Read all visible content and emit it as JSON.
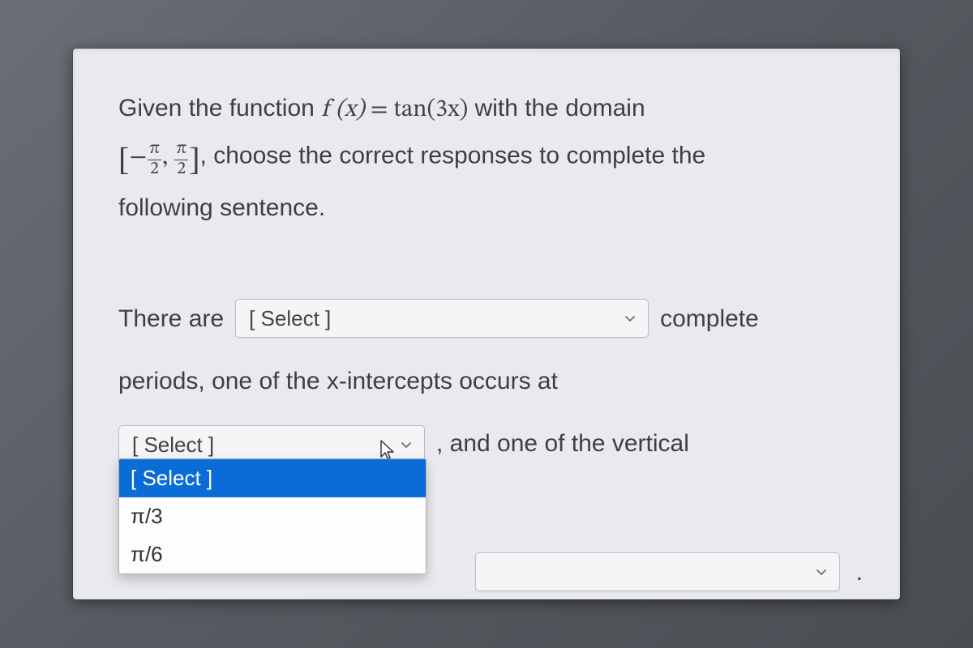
{
  "question": {
    "line1_prefix": "Given the function ",
    "fx": "f (x)",
    "equals": " = ",
    "rhs": "tan(3x)",
    "line1_suffix": " with the domain",
    "interval_open": "[",
    "interval_neg": "−",
    "frac_num": "π",
    "frac_den": "2",
    "interval_sep": ", ",
    "interval_close": "]",
    "line2_suffix": ", choose the correct responses to complete the",
    "line3": "following sentence."
  },
  "sentence": {
    "part1": "There are",
    "select_placeholder": "[ Select ]",
    "part2": "complete",
    "part3": "periods, one of the x-intercepts occurs at",
    "part4": ", and one of the vertical",
    "final_period": "."
  },
  "dropdown2": {
    "header": "[ Select ]",
    "options": [
      "π/3",
      "π/6"
    ]
  }
}
